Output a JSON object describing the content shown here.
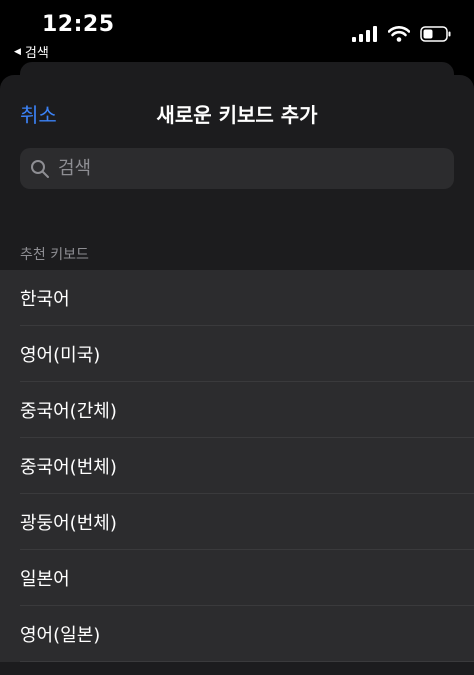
{
  "status_bar": {
    "time": "12:25",
    "back_label": "검색"
  },
  "nav": {
    "cancel_label": "취소",
    "title": "새로운 키보드 추가"
  },
  "search": {
    "placeholder": "검색"
  },
  "section": {
    "header": "추천 키보드",
    "items": [
      {
        "label": "한국어"
      },
      {
        "label": "영어(미국)"
      },
      {
        "label": "중국어(간체)"
      },
      {
        "label": "중국어(번체)"
      },
      {
        "label": "광둥어(번체)"
      },
      {
        "label": "일본어"
      },
      {
        "label": "영어(일본)"
      }
    ]
  },
  "icons": [
    "cellular-signal-icon",
    "wifi-icon",
    "battery-icon",
    "search-icon",
    "back-triangle-icon"
  ],
  "colors": {
    "accent": "#3b82f6",
    "sheet_bg": "#1c1c1e",
    "row_bg": "#2c2c2e",
    "secondary_text": "#8e8e93"
  }
}
